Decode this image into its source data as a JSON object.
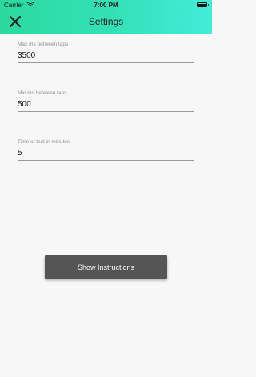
{
  "status_bar": {
    "carrier": "Carrier",
    "time": "7:00 PM"
  },
  "header": {
    "title": "Settings",
    "close_icon": "close-x-icon",
    "gradient": [
      "#2bd99f",
      "#42ecd9"
    ]
  },
  "fields": [
    {
      "label": "Max ms between taps",
      "value": "3500"
    },
    {
      "label": "Min ms between taps",
      "value": "500"
    },
    {
      "label": "Time of test in minutes",
      "value": "5"
    }
  ],
  "instructions_button": {
    "label": "Show Instructions",
    "color": "#555555"
  }
}
